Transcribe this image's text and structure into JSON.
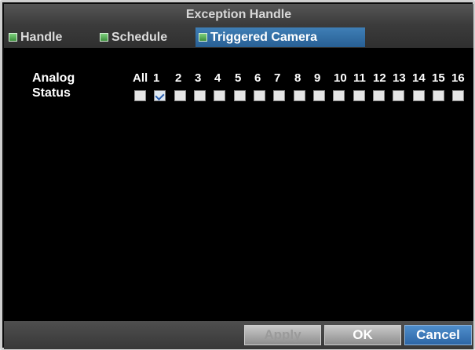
{
  "window": {
    "title": "Exception Handle"
  },
  "tabs": [
    {
      "label": "Handle",
      "active": false
    },
    {
      "label": "Schedule",
      "active": false
    },
    {
      "label": "Triggered Camera",
      "active": true
    }
  ],
  "rows": {
    "analog_label": "Analog",
    "status_label": "Status"
  },
  "cameras": [
    {
      "label": "All",
      "checked": false
    },
    {
      "label": "1",
      "checked": true
    },
    {
      "label": "2",
      "checked": false
    },
    {
      "label": "3",
      "checked": false
    },
    {
      "label": "4",
      "checked": false
    },
    {
      "label": "5",
      "checked": false
    },
    {
      "label": "6",
      "checked": false
    },
    {
      "label": "7",
      "checked": false
    },
    {
      "label": "8",
      "checked": false
    },
    {
      "label": "9",
      "checked": false
    },
    {
      "label": "10",
      "checked": false
    },
    {
      "label": "11",
      "checked": false
    },
    {
      "label": "12",
      "checked": false
    },
    {
      "label": "13",
      "checked": false
    },
    {
      "label": "14",
      "checked": false
    },
    {
      "label": "15",
      "checked": false
    },
    {
      "label": "16",
      "checked": false
    }
  ],
  "buttons": {
    "apply": "Apply",
    "ok": "OK",
    "cancel": "Cancel"
  },
  "colors": {
    "active_tab": "#2f6ea6",
    "primary_button": "#3a78b8",
    "background": "#000000"
  }
}
